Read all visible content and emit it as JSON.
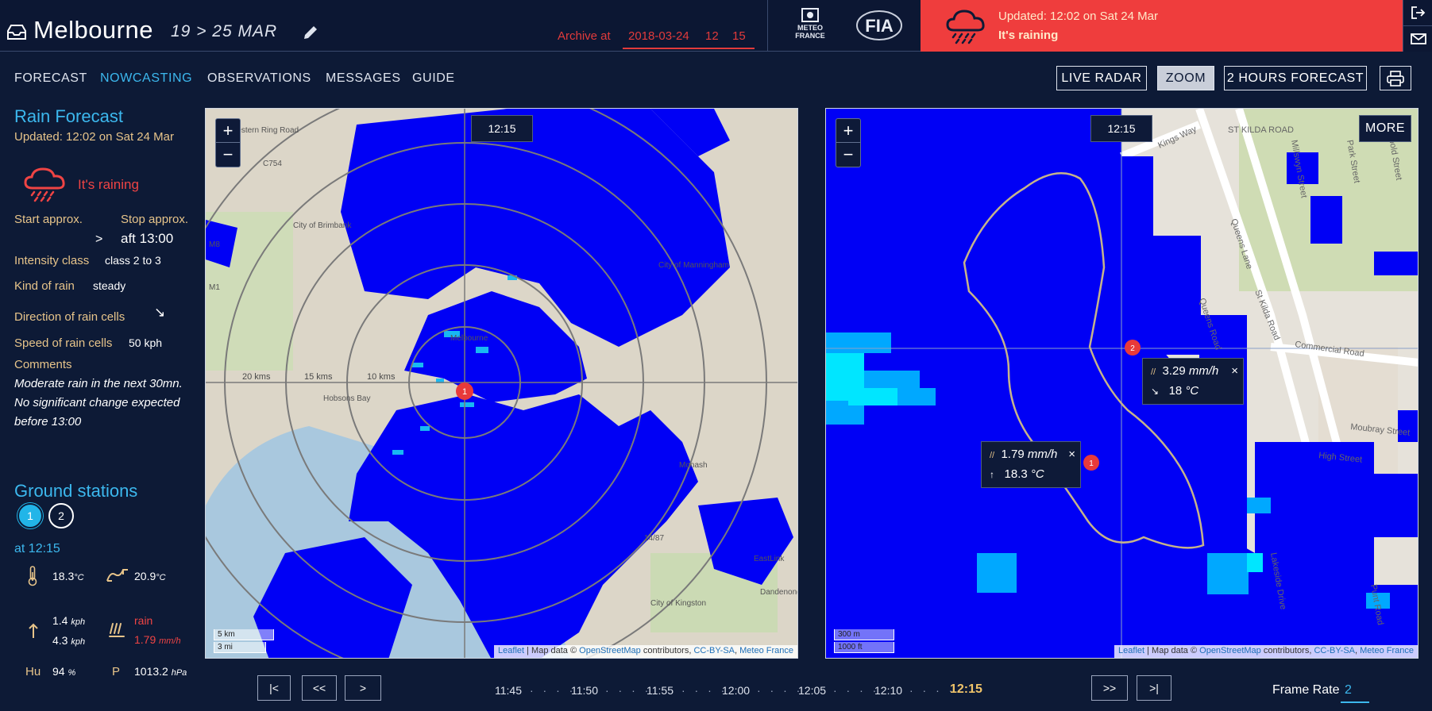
{
  "header": {
    "city": "Melbourne",
    "date_range": "19 > 25 MAR",
    "archive": {
      "label": "Archive at",
      "date": "2018-03-24",
      "hour": "12",
      "minute": "15"
    },
    "logos": {
      "meteo_line1": "METEO",
      "meteo_line2": "FRANCE",
      "fia": "FIA"
    },
    "alert": {
      "updated": "Updated: 12:02 on Sat 24 Mar",
      "status": "It's raining",
      "color": "#ef3d3d"
    }
  },
  "nav": {
    "items": [
      {
        "label": "FORECAST"
      },
      {
        "label": "NOWCASTING",
        "active": true
      },
      {
        "label": "OBSERVATIONS"
      },
      {
        "label": "MESSAGES"
      },
      {
        "label": "GUIDE"
      }
    ],
    "modes": [
      {
        "label": "LIVE RADAR"
      },
      {
        "label": "ZOOM",
        "active": true
      },
      {
        "label": "2 HOURS FORECAST"
      }
    ]
  },
  "sidebar": {
    "title": "Rain Forecast",
    "updated": "Updated: 12:02 on Sat 24 Mar",
    "status": "It's raining",
    "start_label": "Start approx.",
    "start_value": ">",
    "stop_label": "Stop approx.",
    "stop_value": "aft 13:00",
    "intensity_label": "Intensity class",
    "intensity_value": "class 2 to 3",
    "kind_label": "Kind of rain",
    "kind_value": "steady",
    "direction_label": "Direction of rain cells",
    "direction_value": "↘",
    "speed_label": "Speed of rain cells",
    "speed_value": "50 kph",
    "comments_label": "Comments",
    "comments": "Moderate rain in the next 30mn. No significant change expected before 13:00"
  },
  "ground": {
    "title": "Ground stations",
    "stations": [
      "1",
      "2"
    ],
    "time": "at 12:15",
    "temp": "18.3",
    "temp_unit": "°C",
    "dew": "20.9",
    "dew_unit": "°C",
    "wind1": "1.4",
    "wind2": "4.3",
    "wind_unit": "kph",
    "rain_label": "rain",
    "rain_value": "1.79",
    "rain_unit": "mm/h",
    "hu_label": "Hu",
    "hu_value": "94",
    "hu_unit": "%",
    "p_label": "P",
    "p_value": "1013.2",
    "p_unit": "hPa"
  },
  "map_left": {
    "time": "12:15",
    "scale_km": "5 km",
    "scale_mi": "3 mi",
    "ring_labels": [
      "20 kms",
      "15 kms",
      "10 kms"
    ],
    "places": [
      "City of Brimbank",
      "City of Manningham",
      "City of Kingston",
      "Melbourne",
      "Hobsons Bay",
      "Monash",
      "Dandenong",
      "EastLink",
      "C754",
      "M8",
      "M1",
      "14/87",
      "Western Ring Road"
    ],
    "attribution": {
      "leaflet": "Leaflet",
      "text1": " | Map data © ",
      "osm": "OpenStreetMap",
      "text2": " contributors, ",
      "license": "CC-BY-SA",
      "text3": ", ",
      "meteo": "Meteo France"
    }
  },
  "map_right": {
    "time": "12:15",
    "more": "MORE",
    "scale_m": "300 m",
    "scale_ft": "1000 ft",
    "roads": [
      "ST KILDA ROAD",
      "Kings Way",
      "St Kilda Road",
      "Queens Road",
      "Queens Lane",
      "Commercial Road",
      "High Street",
      "Punt Road",
      "Moubray Street",
      "Millswyn Street",
      "Park Street",
      "Leopold Street",
      "Lakeside Drive"
    ],
    "tooltip1": {
      "rain": "3.29",
      "rain_unit": "mm/h",
      "temp": "18",
      "temp_unit": "°C"
    },
    "tooltip2": {
      "rain": "1.79",
      "rain_unit": "mm/h",
      "temp": "18.3",
      "temp_unit": "°C"
    },
    "attribution": {
      "leaflet": "Leaflet",
      "text1": " | Map data © ",
      "osm": "OpenStreetMap",
      "text2": " contributors, ",
      "license": "CC-BY-SA",
      "text3": ", ",
      "meteo": "Meteo France"
    }
  },
  "timeline": {
    "first": "|<",
    "back": "<<",
    "play": ">",
    "forward": ">>",
    "last": ">|",
    "ticks": [
      "11:45",
      "11:50",
      "11:55",
      "12:00",
      "12:05",
      "12:10",
      "12:15"
    ],
    "dots": "· · · ·",
    "frame_rate_label": "Frame Rate",
    "frame_rate": "2"
  },
  "colors": {
    "background": "#0d1a36",
    "accent": "#3cb8ee",
    "label": "#e7c48a",
    "alert": "#ef3d3d",
    "radar_blue": "#0000f5",
    "radar_light": "#00b6ff"
  }
}
